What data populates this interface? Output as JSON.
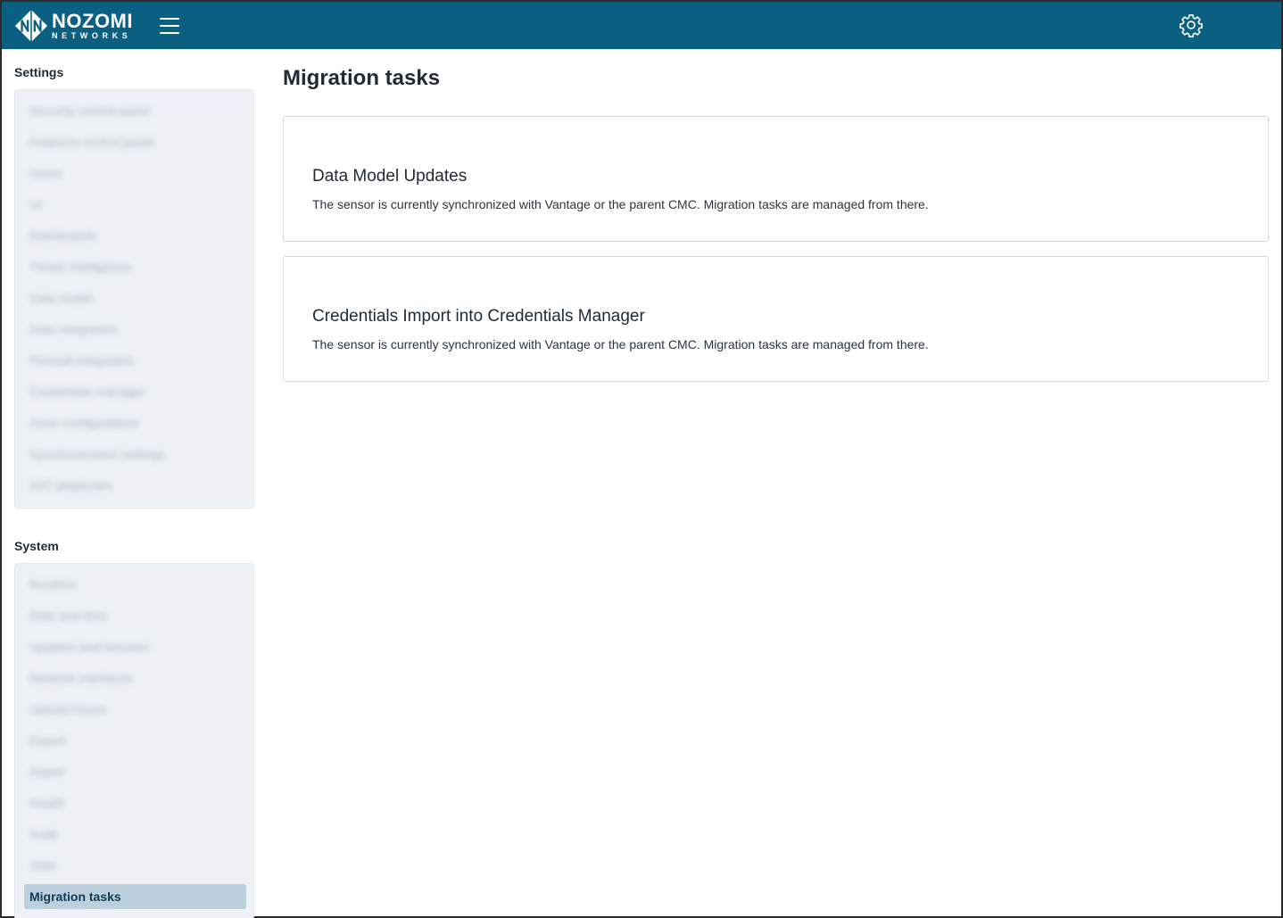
{
  "header": {
    "logo_line1": "NOZOMI",
    "logo_line2": "NETWORKS",
    "brand_color": "#0b5f80"
  },
  "sidebar": {
    "settings_title": "Settings",
    "settings_items": [
      "Security control panel",
      "Features control panel",
      "Users",
      "UI",
      "Dashboards",
      "Threat intelligence",
      "Data model",
      "Data integration",
      "Firewall integration",
      "Credentials manager",
      "Zone configurations",
      "Synchronization settings",
      "SAT playbooks"
    ],
    "system_title": "System",
    "system_items": [
      "Runtime",
      "Date and time",
      "Updates and licenses",
      "Network interfaces",
      "Upload traces",
      "Export",
      "Import",
      "Health",
      "Audit",
      "Jobs"
    ],
    "active_item": "Migration tasks"
  },
  "main": {
    "title": "Migration tasks",
    "cards": [
      {
        "title": "Data Model Updates",
        "description": "The sensor is currently synchronized with Vantage or the parent CMC. Migration tasks are managed from there."
      },
      {
        "title": "Credentials Import into Credentials Manager",
        "description": "The sensor is currently synchronized with Vantage or the parent CMC. Migration tasks are managed from there."
      }
    ]
  }
}
